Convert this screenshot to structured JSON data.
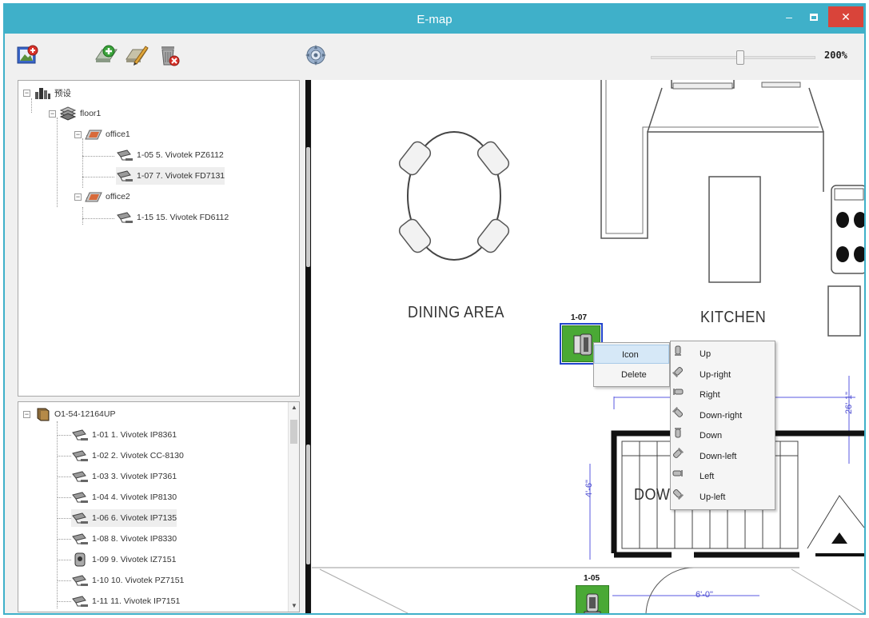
{
  "window": {
    "title": "E-map",
    "min_glyph": "–",
    "close_glyph": "✕"
  },
  "toolbar": {
    "zoom_level": "200%",
    "zoom_fraction": 0.54,
    "icons": [
      "open-map-icon",
      "add-map-icon",
      "edit-map-icon",
      "delete-map-icon",
      "settings-gear-icon"
    ]
  },
  "map_tree": {
    "root": "预设",
    "floor": "floor1",
    "office1": "office1",
    "office1_cams": [
      "1-05 5. Vivotek PZ6112",
      "1-07 7. Vivotek FD7131"
    ],
    "office2": "office2",
    "office2_cams": [
      "1-15 15. Vivotek FD6112"
    ]
  },
  "device_tree": {
    "root": "O1-54-12164UP",
    "cams": [
      "1-01 1. Vivotek IP8361",
      "1-02 2. Vivotek CC-8130",
      "1-03 3. Vivotek IP7361",
      "1-04 4. Vivotek IP8130",
      "1-06 6. Vivotek IP7135",
      "1-08 8. Vivotek IP8330",
      "1-09 9. Vivotek IZ7151",
      "1-10 10. Vivotek PZ7151",
      "1-11 11. Vivotek IP7151"
    ]
  },
  "map": {
    "dining_label": "DINING AREA",
    "kitchen_label": "KITCHEN",
    "down_label": "DOW",
    "dim_left": "4'-6\"",
    "dim_bottom": "6'-0\"",
    "dim_right": "26'-1\"",
    "cam1_id": "1-07",
    "cam2_id": "1-05"
  },
  "context_menu": {
    "items": [
      "Icon",
      "Delete"
    ]
  },
  "direction_menu": {
    "items": [
      "Up",
      "Up-right",
      "Right",
      "Down-right",
      "Down",
      "Down-left",
      "Left",
      "Up-left"
    ]
  }
}
